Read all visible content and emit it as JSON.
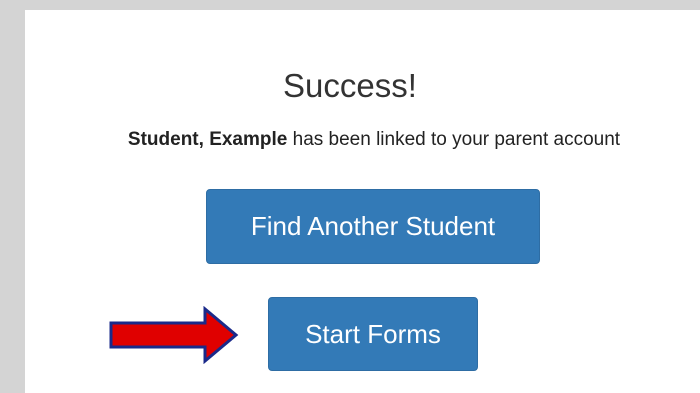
{
  "result": {
    "title": "Success!",
    "student_name": "Student, Example",
    "message_suffix": " has been linked to your parent account"
  },
  "actions": {
    "find_another_label": "Find Another Student",
    "start_forms_label": "Start Forms"
  },
  "colors": {
    "button_primary": "#337ab7",
    "arrow_fill": "#e00000",
    "arrow_outline": "#1a2a8a",
    "backdrop": "#d4d4d4"
  },
  "icons": {
    "annotation": "red-arrow-icon"
  }
}
